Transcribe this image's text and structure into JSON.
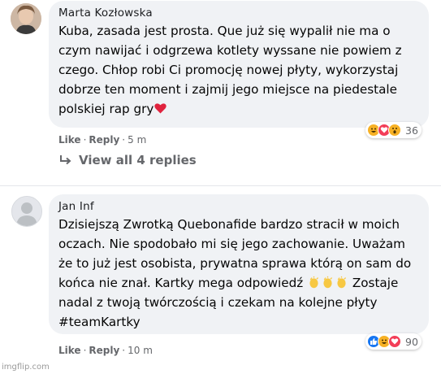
{
  "comments": [
    {
      "author": "Marta Kozłowska",
      "lines": [
        "Kuba, zasada jest prosta. Que już się wypalił nie ma o",
        "czym nawijać i odgrzewa kotlety wyssane nie powiem z",
        "czego. Chłop robi Ci promocję nowej płyty, wykorzystaj",
        "dobrze ten moment i zajmij jego miejsce na piedestale",
        "polskiej rap gry"
      ],
      "reaction_count": "36",
      "reactions": [
        "haha-icon",
        "love-icon",
        "wow-icon"
      ],
      "like_label": "Like",
      "reply_label": "Reply",
      "separator": "·",
      "time": "5 m",
      "view_replies": "View all 4 replies"
    },
    {
      "author": "Jan Inf",
      "lines": [
        "Dzisiejszą Zwrotką Quebonafide bardzo stracił w moich",
        "oczach. Nie spodobało mi się jego zachowanie. Uważam",
        "że to już jest osobista, prywatna sprawa którą on sam do",
        "końca nie znał. Kartky mega odpowiedź",
        " Zostaje",
        "nadal z twoją twórczością i czekam na kolejne płyty",
        "#teamKartky"
      ],
      "reaction_count": "90",
      "reactions": [
        "like-icon",
        "haha-icon",
        "love-icon"
      ],
      "like_label": "Like",
      "reply_label": "Reply",
      "separator": "·",
      "time": "10 m"
    }
  ],
  "watermark": "imgflip.com",
  "colors": {
    "bubble": "#f0f2f5",
    "meta_text": "#65676b",
    "like_blue": "#1877f2",
    "love_red": "#f33e58",
    "haha_yellow": "#f7b125"
  }
}
